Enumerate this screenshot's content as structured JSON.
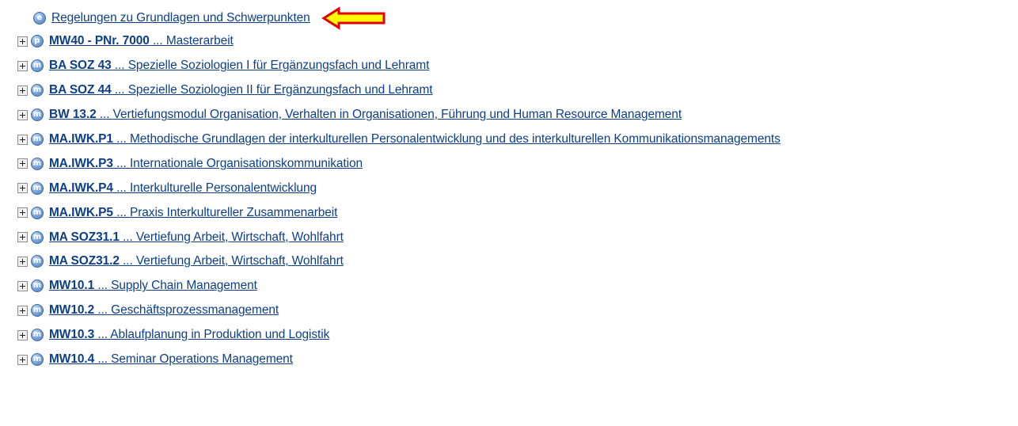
{
  "root": {
    "icon_letter": "e",
    "label": "Regelungen zu Grundlagen und Schwerpunkten",
    "annotation_color": "#ffff00",
    "annotation_outline": "#e00000"
  },
  "items": [
    {
      "icon_letter": "p",
      "code": "MW40 - PNr. 7000",
      "sep": " ... ",
      "title": "Masterarbeit"
    },
    {
      "icon_letter": "m",
      "code": "BA SOZ 43",
      "sep": " ... ",
      "title": "Spezielle Soziologien I für Ergänzungsfach und Lehramt"
    },
    {
      "icon_letter": "m",
      "code": "BA SOZ 44",
      "sep": " ... ",
      "title": "Spezielle Soziologien II für Ergänzungsfach und Lehramt"
    },
    {
      "icon_letter": "m",
      "code": "BW 13.2",
      "sep": " ... ",
      "title": "Vertiefungsmodul Organisation, Verhalten in Organisationen, Führung und Human Resource Management"
    },
    {
      "icon_letter": "m",
      "code": "MA.IWK.P1",
      "sep": " ... ",
      "title": "Methodische Grundlagen der interkulturellen Personalentwicklung und des interkulturellen Kommunikationsmanagements"
    },
    {
      "icon_letter": "m",
      "code": "MA.IWK.P3",
      "sep": " ... ",
      "title": "Internationale Organisationskommunikation"
    },
    {
      "icon_letter": "m",
      "code": "MA.IWK.P4",
      "sep": " ... ",
      "title": "Interkulturelle Personalentwicklung"
    },
    {
      "icon_letter": "m",
      "code": "MA.IWK.P5",
      "sep": " ... ",
      "title": "Praxis Interkultureller Zusammenarbeit"
    },
    {
      "icon_letter": "m",
      "code": "MA SOZ31.1",
      "sep": " ... ",
      "title": "Vertiefung Arbeit, Wirtschaft, Wohlfahrt"
    },
    {
      "icon_letter": "m",
      "code": "MA SOZ31.2",
      "sep": " ... ",
      "title": "Vertiefung Arbeit, Wirtschaft, Wohlfahrt"
    },
    {
      "icon_letter": "m",
      "code": "MW10.1",
      "sep": " ... ",
      "title": "Supply Chain Management"
    },
    {
      "icon_letter": "m",
      "code": "MW10.2",
      "sep": " ... ",
      "title": "Geschäftsprozessmanagement"
    },
    {
      "icon_letter": "m",
      "code": "MW10.3",
      "sep": " ... ",
      "title": "Ablaufplanung in Produktion und Logistik"
    },
    {
      "icon_letter": "m",
      "code": "MW10.4",
      "sep": " ... ",
      "title": "Seminar Operations Management"
    }
  ]
}
